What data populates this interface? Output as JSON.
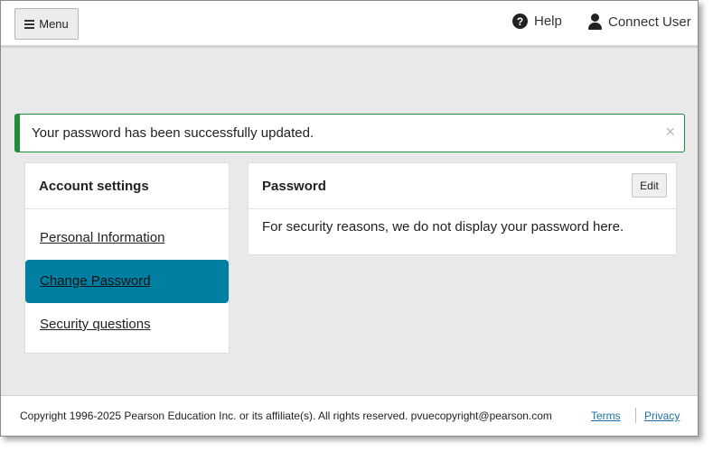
{
  "header": {
    "menu_label": "Menu",
    "menu_icon": "hamburger-icon",
    "help_label": "Help",
    "help_icon": "question-circle-icon",
    "connect_label": "Connect User",
    "connect_icon": "user-icon"
  },
  "alert": {
    "message": "Your password has been successfully updated.",
    "close_glyph": "×",
    "color": "#1e8c3a"
  },
  "sidebar": {
    "title": "Account settings",
    "items": [
      {
        "label": "Personal Information",
        "active": false
      },
      {
        "label": "Change Password",
        "active": true
      },
      {
        "label": "Security questions",
        "active": false
      }
    ],
    "active_color": "#007fa3"
  },
  "panel": {
    "title": "Password",
    "edit_label": "Edit",
    "body": "For security reasons, we do not display your password here."
  },
  "footer": {
    "copyright": "Copyright 1996-2025 Pearson Education Inc. or its affiliate(s). All rights reserved. pvuecopyright@pearson.com",
    "terms_label": "Terms",
    "privacy_label": "Privacy"
  }
}
